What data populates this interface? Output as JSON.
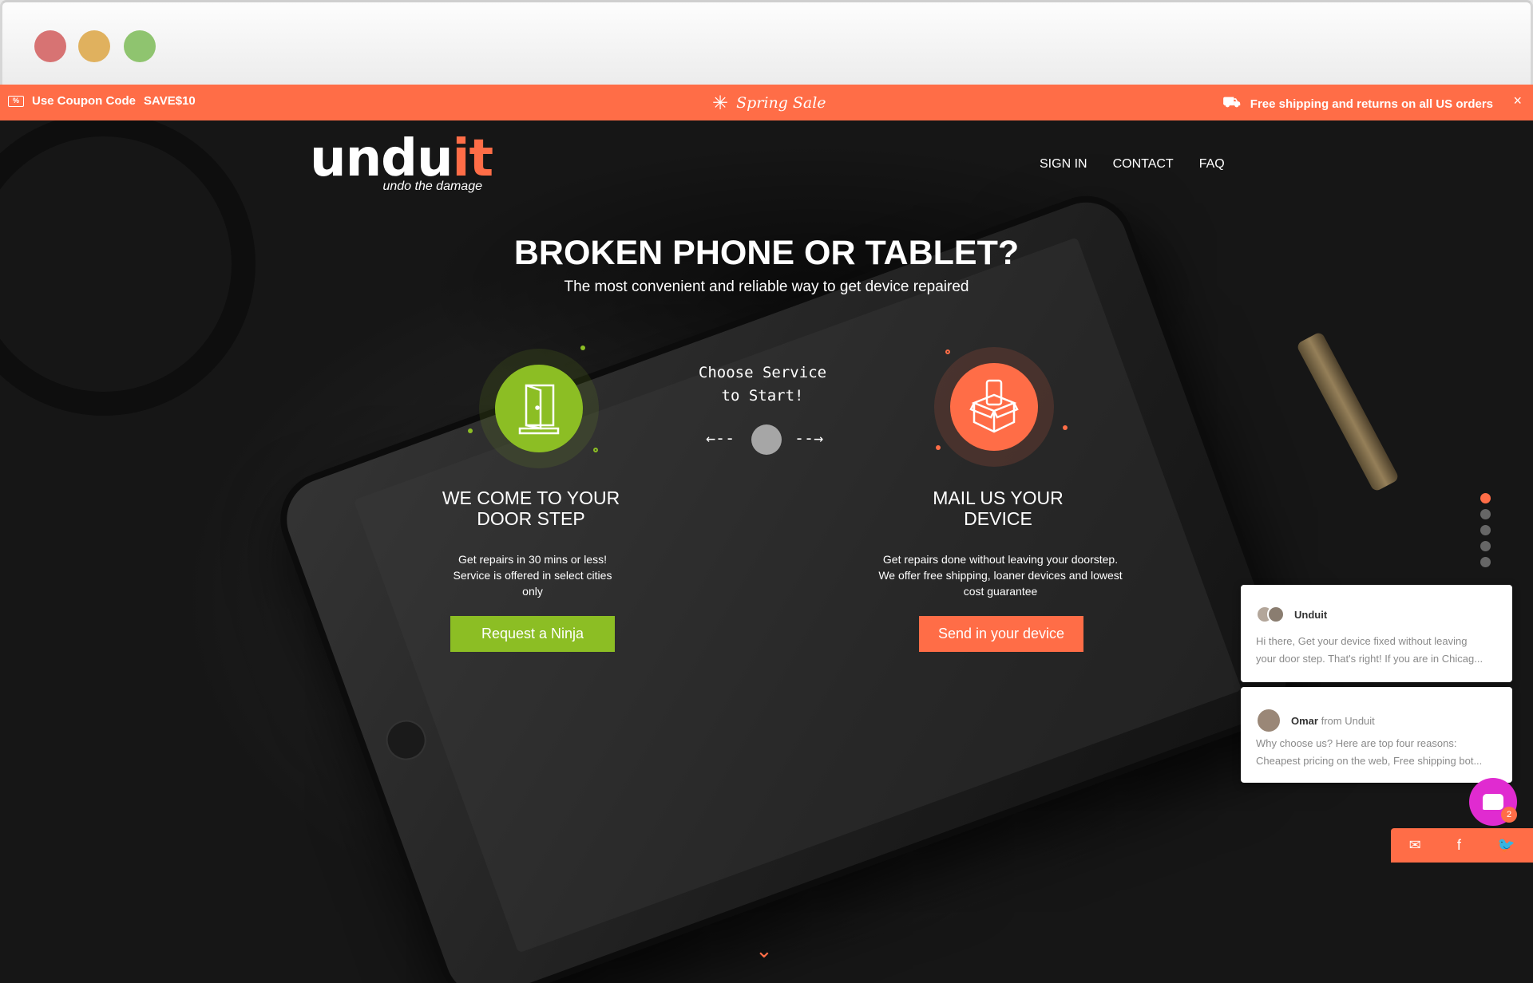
{
  "promo": {
    "coupon_prefix": "Use Coupon Code",
    "coupon_code": "SAVE$10",
    "sale_text": "Spring Sale",
    "shipping_text": "Free shipping and returns on all US orders",
    "close": "×",
    "accent_color": "#ff6d47"
  },
  "header": {
    "logo_main": "undu",
    "logo_accent": "it",
    "logo_tagline": "undo the damage",
    "nav": [
      "SIGN IN",
      "CONTACT",
      "FAQ"
    ]
  },
  "hero": {
    "headline": "BROKEN PHONE OR TABLET?",
    "subheadline": "The most convenient and reliable way to get device repaired",
    "choose_line1": "Choose Service",
    "choose_line2": "to Start!",
    "arrow_left": "←--",
    "arrow_right": "--→",
    "left_service": {
      "icon": "door-icon",
      "title_line1": "WE COME TO YOUR",
      "title_line2": "DOOR STEP",
      "desc_line1": "Get repairs in 30 mins or less!",
      "desc_line2": "Service is offered in select cities",
      "desc_line3": "only",
      "button": "Request a Ninja",
      "color": "#8cbe24"
    },
    "right_service": {
      "icon": "package-phone-icon",
      "title_line1": "MAIL US YOUR",
      "title_line2": "DEVICE",
      "desc_line1": "Get repairs done without leaving your doorstep.",
      "desc_line2": "We offer free shipping, loaner devices and lowest",
      "desc_line3": "cost guarantee",
      "button": "Send in your device",
      "color": "#ff6d47"
    },
    "scroll_icon": "chevron-down-icon"
  },
  "chat": {
    "message1": {
      "sender": "Unduit",
      "line1": "Hi there, Get your device fixed without leaving",
      "line2": "your door step. That's right! If you are in Chicag..."
    },
    "message2": {
      "sender": "Omar",
      "from": "from Unduit",
      "line1": "Why choose us? Here are top four reasons:",
      "line2": "Cheapest pricing on the web, Free shipping bot..."
    },
    "badge_count": "2"
  },
  "share": {
    "email_icon": "✉",
    "facebook_icon": "f",
    "twitter_icon": "🐦"
  }
}
